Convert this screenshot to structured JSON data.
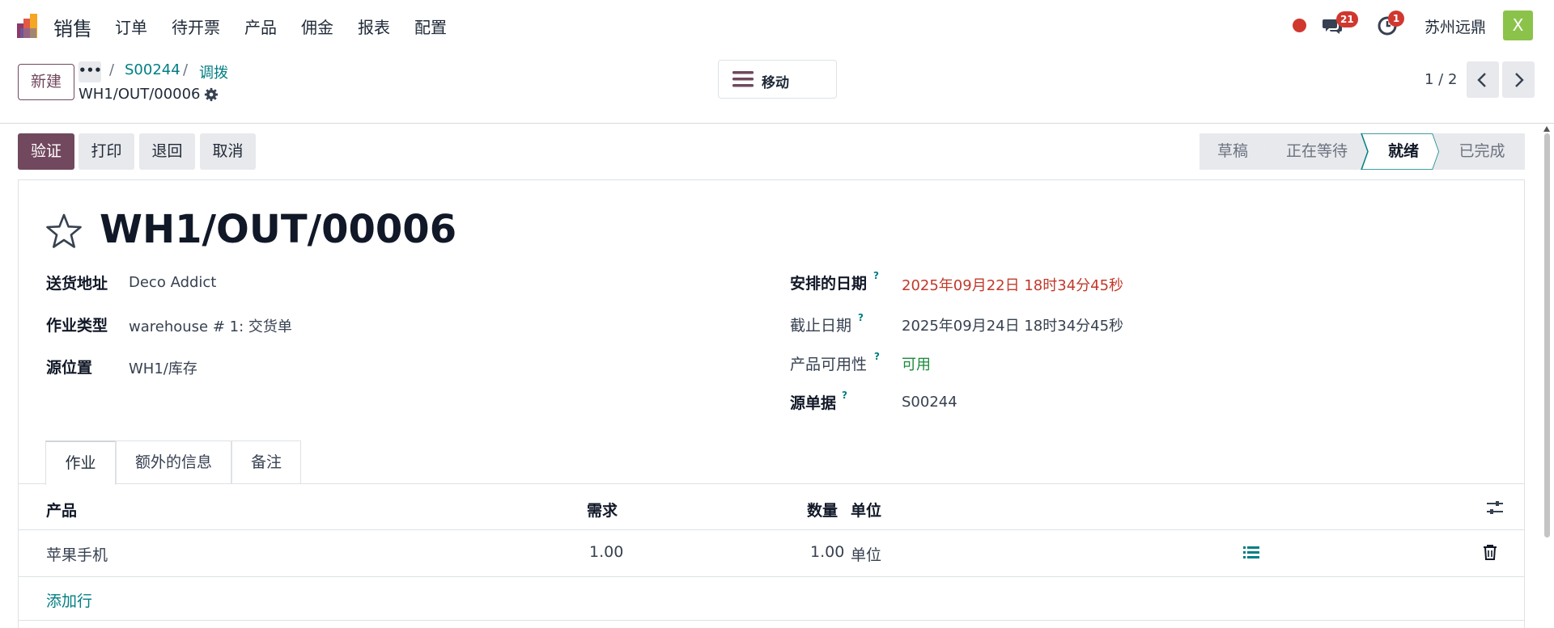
{
  "nav": {
    "app_name": "销售",
    "menu": [
      "订单",
      "待开票",
      "产品",
      "佣金",
      "报表",
      "配置"
    ],
    "messages_count": "21",
    "activities_count": "1",
    "company": "苏州远鼎",
    "avatar_letter": "X"
  },
  "control": {
    "new_label": "新建",
    "more_label": "•••",
    "breadcrumbs": [
      "S00244",
      "调拨"
    ],
    "record_name": "WH1/OUT/00006",
    "move_label": "移动",
    "pager": "1 / 2"
  },
  "actions": [
    "验证",
    "打印",
    "退回",
    "取消"
  ],
  "stages": [
    "草稿",
    "正在等待",
    "就绪",
    "已完成"
  ],
  "active_stage": "就绪",
  "form": {
    "title": "WH1/OUT/00006",
    "left": [
      {
        "label": "送货地址",
        "value": "Deco Addict"
      },
      {
        "label": "作业类型",
        "value": "warehouse # 1: 交货单"
      },
      {
        "label": "源位置",
        "value": "WH1/库存"
      }
    ],
    "right": [
      {
        "label": "安排的日期",
        "value": "2025年09月22日 18时34分45秒"
      },
      {
        "label": "截止日期",
        "value": "2025年09月24日 18时34分45秒"
      },
      {
        "label": "产品可用性",
        "value": "可用"
      },
      {
        "label": "源单据",
        "value": "S00244"
      }
    ],
    "help_mark": "?"
  },
  "tabs": [
    "作业",
    "额外的信息",
    "备注"
  ],
  "table": {
    "headers": [
      "产品",
      "需求",
      "数量",
      "单位"
    ],
    "rows": [
      {
        "product": "苹果手机",
        "demand": "1.00",
        "quantity": "1.00",
        "uom": "单位"
      }
    ],
    "add_line": "添加行"
  },
  "colors": {
    "primary": "#71485e",
    "link": "#017e84",
    "danger": "#c0392b",
    "success": "#1a8a3a"
  }
}
